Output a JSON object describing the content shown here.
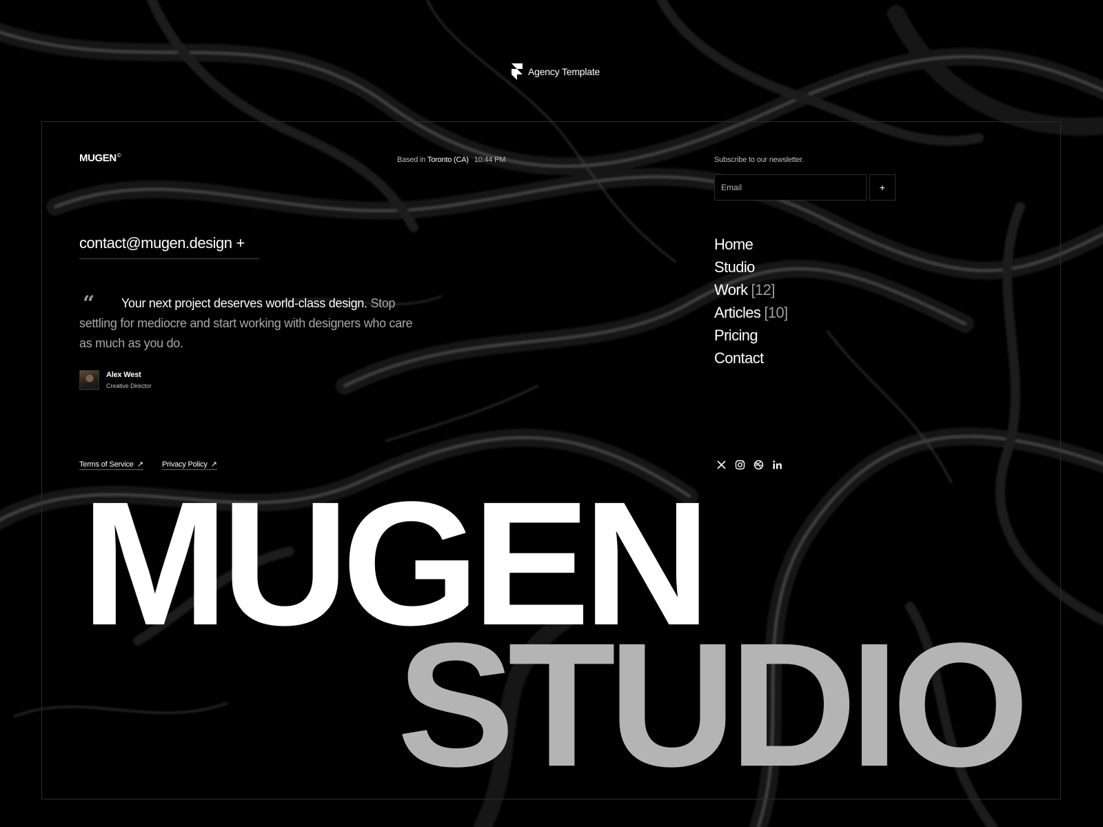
{
  "brand_bar": {
    "label": "Agency Template"
  },
  "header": {
    "logo": "MUGEN",
    "logo_mark": "©",
    "location_prefix": "Based in",
    "location_city": "Toronto (CA)",
    "time": "10:44 PM"
  },
  "newsletter": {
    "label": "Subscribe to our newsletter.",
    "email_placeholder": "Email",
    "email_value": "",
    "submit_label": "+"
  },
  "contact": {
    "email": "contact@mugen.design",
    "plus": "+"
  },
  "testimonial": {
    "quote_mark": "“",
    "quote_lead": "Your next project deserves world-class design.",
    "quote_rest": "Stop settling for mediocre and start working with designers who care as much as you do.",
    "author_name": "Alex West",
    "author_role": "Creative Director"
  },
  "nav": {
    "items": [
      {
        "label": "Home",
        "count": ""
      },
      {
        "label": "Studio",
        "count": ""
      },
      {
        "label": "Work",
        "count": "[12]"
      },
      {
        "label": "Articles",
        "count": "[10]"
      },
      {
        "label": "Pricing",
        "count": ""
      },
      {
        "label": "Contact",
        "count": ""
      }
    ]
  },
  "footer": {
    "terms": "Terms of Service",
    "privacy": "Privacy Policy",
    "arrow": "↗",
    "social_icons": [
      "x-icon",
      "instagram-icon",
      "dribbble-icon",
      "linkedin-icon"
    ]
  },
  "hero": {
    "line1": "MUGEN",
    "line2": "STUDIO"
  },
  "colors": {
    "background": "#000000",
    "text": "#ffffff",
    "muted": "#a8a8a8",
    "hero_secondary": "#b4b4b4"
  }
}
